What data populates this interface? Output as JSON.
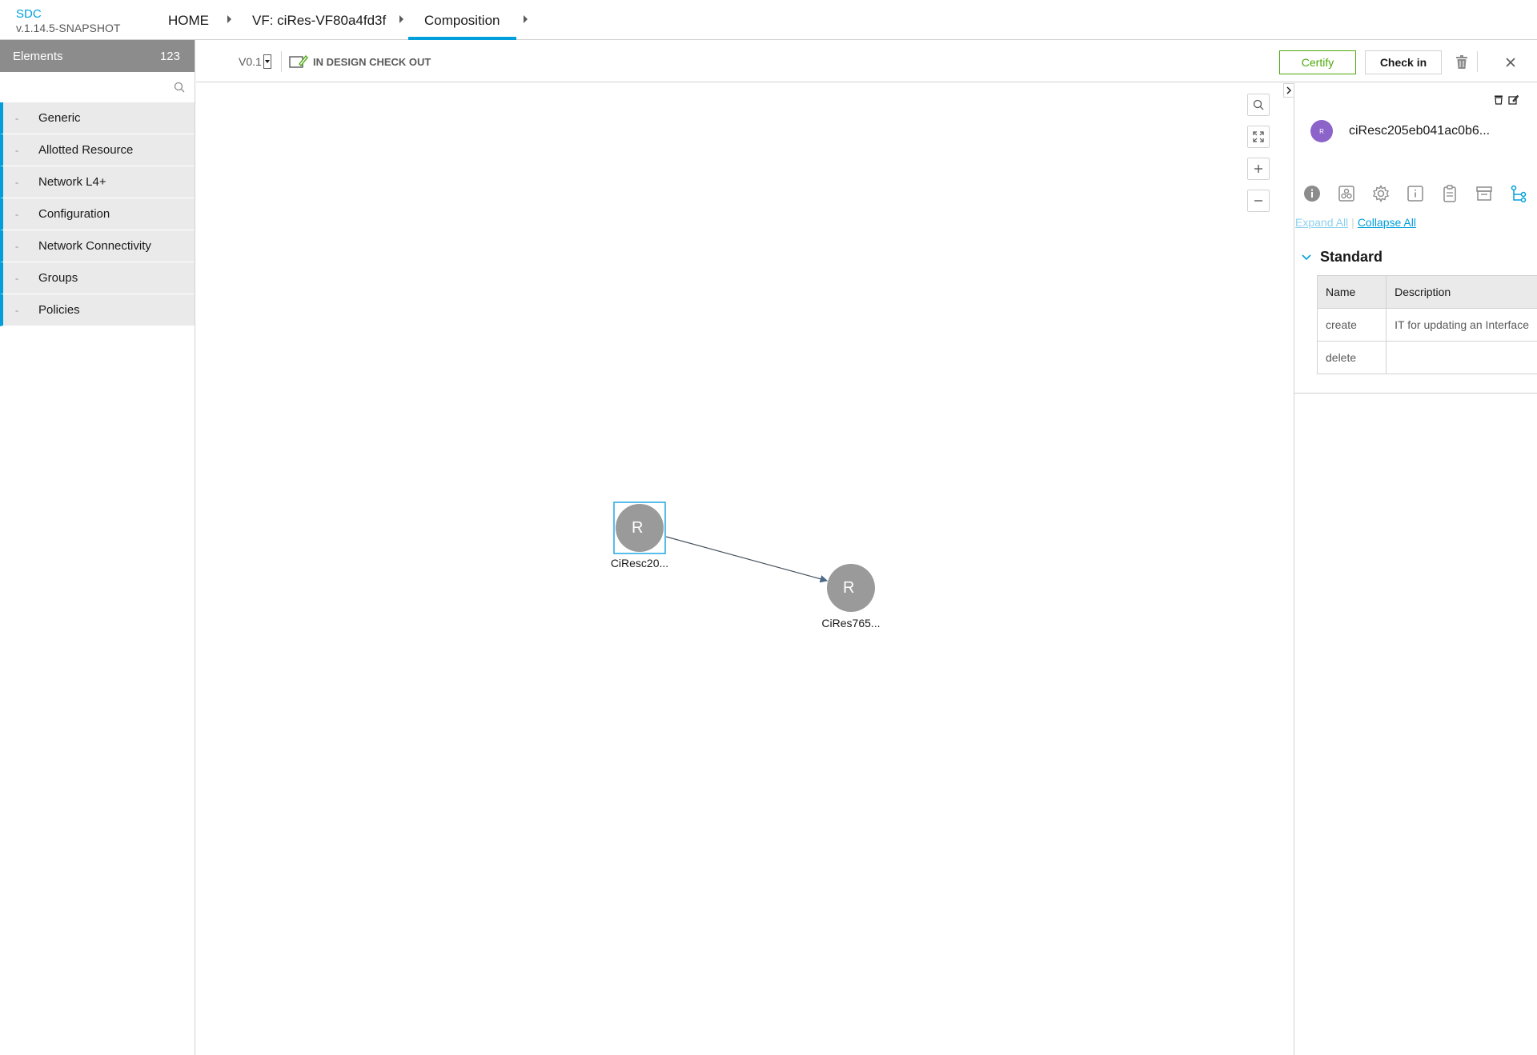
{
  "brand": {
    "name": "SDC",
    "version": "v.1.14.5-SNAPSHOT"
  },
  "breadcrumbs": [
    {
      "label": "HOME"
    },
    {
      "label": "VF: ciRes-VF80a4fd3f"
    },
    {
      "label": "Composition"
    }
  ],
  "palette": {
    "title": "Elements",
    "count": "123",
    "search_placeholder": "",
    "categories": [
      {
        "label": "Generic"
      },
      {
        "label": "Allotted Resource"
      },
      {
        "label": "Network L4+"
      },
      {
        "label": "Configuration"
      },
      {
        "label": "Network Connectivity"
      },
      {
        "label": "Groups"
      },
      {
        "label": "Policies"
      }
    ]
  },
  "workspace": {
    "version": "V0.1",
    "status": "IN DESIGN CHECK OUT",
    "certify_label": "Certify",
    "checkin_label": "Check in"
  },
  "canvas": {
    "nodes": [
      {
        "letter": "R",
        "label": "CiResc20..."
      },
      {
        "letter": "R",
        "label": "CiRes765..."
      }
    ]
  },
  "right_panel": {
    "avatar_letter": "R",
    "component_name": "ciResc205eb041ac0b6...",
    "expand_all": "Expand All",
    "collapse_all": "Collapse All",
    "group_title": "Standard",
    "table": {
      "headers": [
        "Name",
        "Description"
      ],
      "rows": [
        {
          "name": "create",
          "description": "IT for updating an Interface"
        },
        {
          "name": "delete",
          "description": ""
        }
      ]
    }
  },
  "colors": {
    "accent": "#009fdb",
    "certify": "#4ca90c",
    "avatar": "#8b63c9"
  }
}
